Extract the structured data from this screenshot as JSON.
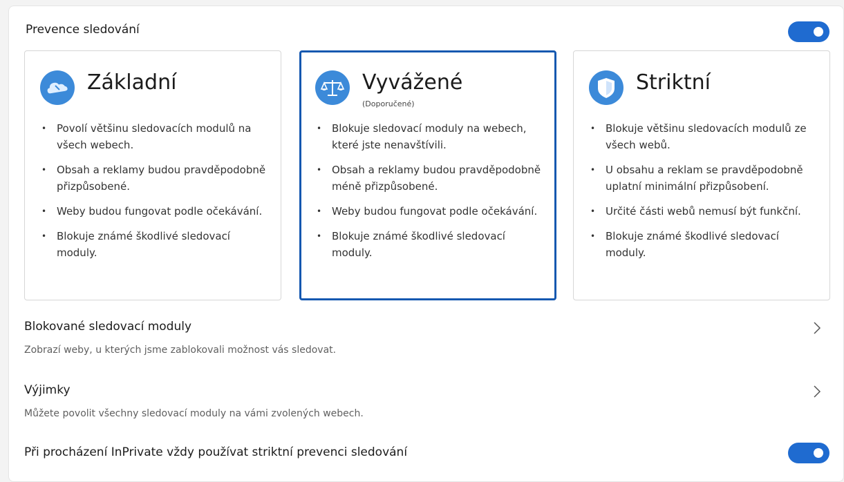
{
  "tracking_prevention": {
    "title": "Prevence sledování",
    "enabled": true
  },
  "cards": [
    {
      "title": "Základní",
      "subtitle": "",
      "icon": "basic-cloud-icon",
      "selected": false,
      "bullets": [
        "Povolí většinu sledovacích modulů na všech webech.",
        "Obsah a reklamy budou pravděpodobně přizpůsobené.",
        "Weby budou fungovat podle očekávání.",
        "Blokuje známé škodlivé sledovací moduly."
      ]
    },
    {
      "title": "Vyvážené",
      "subtitle": "(Doporučené)",
      "icon": "balance-scale-icon",
      "selected": true,
      "bullets": [
        "Blokuje sledovací moduly na webech, které jste nenavštívili.",
        "Obsah a reklamy budou pravděpodobně méně přizpůsobené.",
        "Weby budou fungovat podle očekávání.",
        "Blokuje známé škodlivé sledovací moduly."
      ]
    },
    {
      "title": "Striktní",
      "subtitle": "",
      "icon": "shield-icon",
      "selected": false,
      "bullets": [
        "Blokuje většinu sledovacích modulů ze všech webů.",
        "U obsahu a reklam se pravděpodobně uplatní minimální přizpůsobení.",
        "Určité části webů nemusí být funkční.",
        "Blokuje známé škodlivé sledovací moduly."
      ]
    }
  ],
  "blocked_trackers": {
    "title": "Blokované sledovací moduly",
    "description": "Zobrazí weby, u kterých jsme zablokovali možnost vás sledovat."
  },
  "exceptions": {
    "title": "Výjimky",
    "description": "Můžete povolit všechny sledovací moduly na vámi zvolených webech."
  },
  "inprivate": {
    "title": "Při procházení InPrivate vždy používat striktní prevenci sledování",
    "enabled": true
  },
  "colors": {
    "accent": "#1f6bd0",
    "selected_border": "#1558b0",
    "icon_bg": "#3c8ad9"
  }
}
